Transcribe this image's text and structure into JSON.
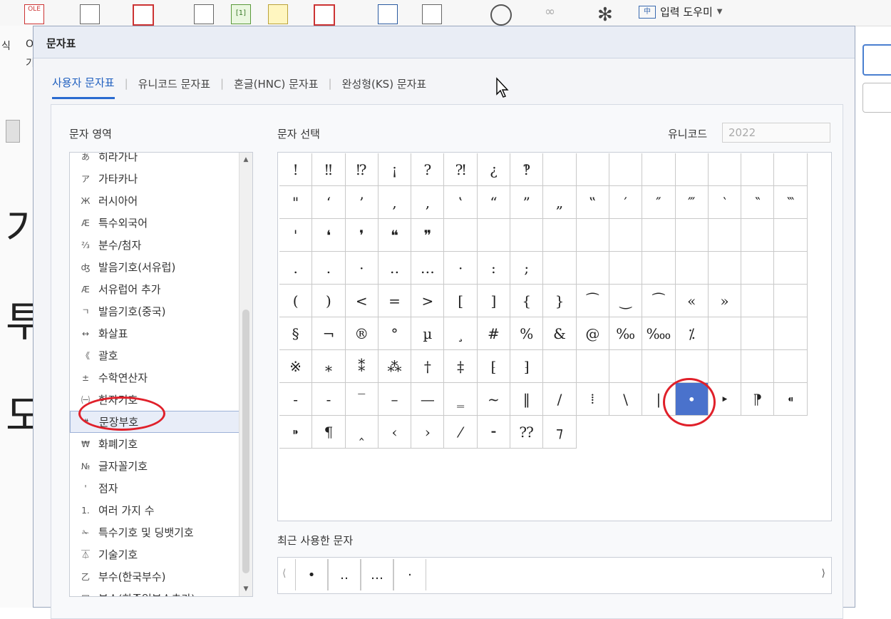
{
  "app": {
    "ole_label": "OLE",
    "input_helper_label": "입력 도우미",
    "input_helper_icon": "中",
    "side_fragment_1": "식",
    "side_fragment_2": "O",
    "side_fragment_3": "기",
    "bg_glyphs": [
      "가",
      "투",
      "도"
    ]
  },
  "dialog": {
    "title": "문자표",
    "tabs": [
      {
        "label": "사용자 문자표",
        "active": true
      },
      {
        "label": "유니코드 문자표",
        "active": false
      },
      {
        "label": "혼글(HNC) 문자표",
        "active": false
      },
      {
        "label": "완성형(KS) 문자표",
        "active": false
      }
    ],
    "area_label": "문자 영역",
    "select_label": "문자 선택",
    "unicode_label": "유니코드",
    "unicode_value": "2022",
    "recent_label": "최근 사용한 문자",
    "areas": [
      {
        "icon": "あ",
        "label": "히라가나"
      },
      {
        "icon": "ア",
        "label": "가타카나"
      },
      {
        "icon": "Ж",
        "label": "러시아어"
      },
      {
        "icon": "Æ",
        "label": "특수외국어"
      },
      {
        "icon": "⅔",
        "label": "분수/첨자"
      },
      {
        "icon": "ʤ",
        "label": "발음기호(서유럽)"
      },
      {
        "icon": "Æ",
        "label": "서유럽어 추가"
      },
      {
        "icon": "ㄱ",
        "label": "발음기호(중국)"
      },
      {
        "icon": "↔",
        "label": "화살표"
      },
      {
        "icon": "《",
        "label": "괄호"
      },
      {
        "icon": "±",
        "label": "수학연산자"
      },
      {
        "icon": "㈠",
        "label": "한자기호"
      },
      {
        "icon": "❝",
        "label": "문장부호",
        "selected": true
      },
      {
        "icon": "₩",
        "label": "화폐기호"
      },
      {
        "icon": "№",
        "label": "글자꼴기호"
      },
      {
        "icon": "'",
        "label": "점자"
      },
      {
        "icon": "1.",
        "label": "여러 가지 수"
      },
      {
        "icon": "✁",
        "label": "특수기호 및 딩뱃기호"
      },
      {
        "icon": "⏄",
        "label": "기술기호"
      },
      {
        "icon": "乙",
        "label": "부수(한국부수)"
      },
      {
        "icon": "⼌",
        "label": "부수(한중일부수추가)"
      }
    ],
    "chars": [
      "!",
      "‼",
      "⁉",
      "¡",
      "?",
      "⁈",
      "¿",
      "‽",
      "",
      "",
      "",
      "",
      "",
      "",
      "",
      "",
      "\"",
      "‘",
      "’",
      ",",
      "‚",
      "‛",
      "“",
      "”",
      "„",
      "‟",
      "′",
      "″",
      "‴",
      "‵",
      "‶",
      "‷",
      "'",
      "❛",
      "❜",
      "❝",
      "❞",
      "",
      "",
      "",
      "",
      "",
      "",
      "",
      "",
      "",
      "",
      "",
      ".",
      ".",
      "·",
      "‥",
      "…",
      "·",
      ":",
      ";",
      "",
      "",
      "",
      "",
      "",
      "",
      "",
      "",
      "(",
      ")",
      "<",
      "=",
      ">",
      "[",
      "]",
      "{",
      "}",
      "⁀",
      "‿",
      "⁀",
      "«",
      "»",
      "",
      "",
      "§",
      "¬",
      "®",
      "°",
      "µ",
      "¸",
      "#",
      "%",
      "&",
      "@",
      "‰",
      "‱",
      "⁒",
      "",
      "",
      "",
      "※",
      "⁎",
      "⁑",
      "⁂",
      "†",
      "‡",
      "⁅",
      "⁆",
      "",
      "",
      "",
      "",
      "",
      "",
      "",
      "",
      "‐",
      "‑",
      "‾",
      "–",
      "—",
      "‗",
      "~",
      "‖",
      "/",
      "⁞",
      "\\",
      "|",
      "•",
      "‣",
      "⁋",
      "⁌",
      "⁍",
      "¶",
      "‸",
      "‹",
      "›",
      "⁄",
      "⁃",
      "⁇",
      "⁊"
    ],
    "selected_char_index": 124,
    "recent_chars": [
      "•",
      "‥",
      "…",
      "·"
    ]
  }
}
